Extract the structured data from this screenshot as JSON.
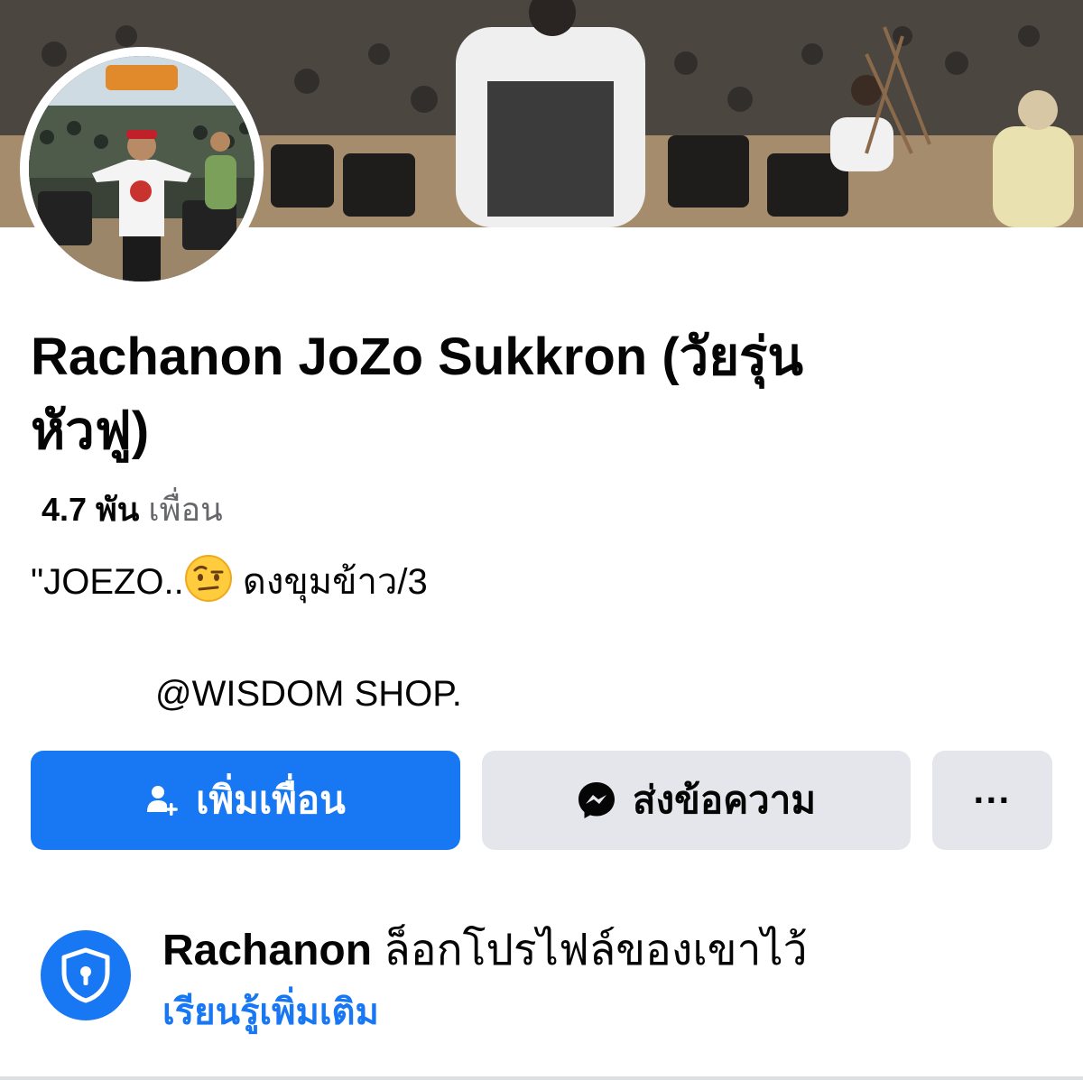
{
  "profile": {
    "name_line1": "Rachanon JoZo Sukkron (วัยรุ่น",
    "name_line2": "หัวฟู)",
    "friends_count": "4.7 พัน",
    "friends_label": "เพื่อน",
    "bio_line1_prefix": "\"JOEZO..",
    "bio_emoji": "face-with-raised-eyebrow",
    "bio_line1_suffix": " ดงขุมข้าว/3",
    "bio_line2": "@WISDOM SHOP."
  },
  "actions": {
    "add_friend_label": "เพิ่มเพื่อน",
    "message_label": "ส่งข้อความ",
    "more_label": "···"
  },
  "locked": {
    "name": "Rachanon",
    "text": " ล็อกโปรไฟล์ของเขาไว้",
    "learn_more": "เรียนรู้เพิ่มเติม"
  },
  "colors": {
    "primary": "#1877f2",
    "secondary_button": "#e4e6eb",
    "muted_text": "#65676b",
    "text": "#050505"
  },
  "icons": [
    "add-friend-icon",
    "messenger-icon",
    "more-icon",
    "shield-lock-icon",
    "face-with-raised-eyebrow"
  ]
}
